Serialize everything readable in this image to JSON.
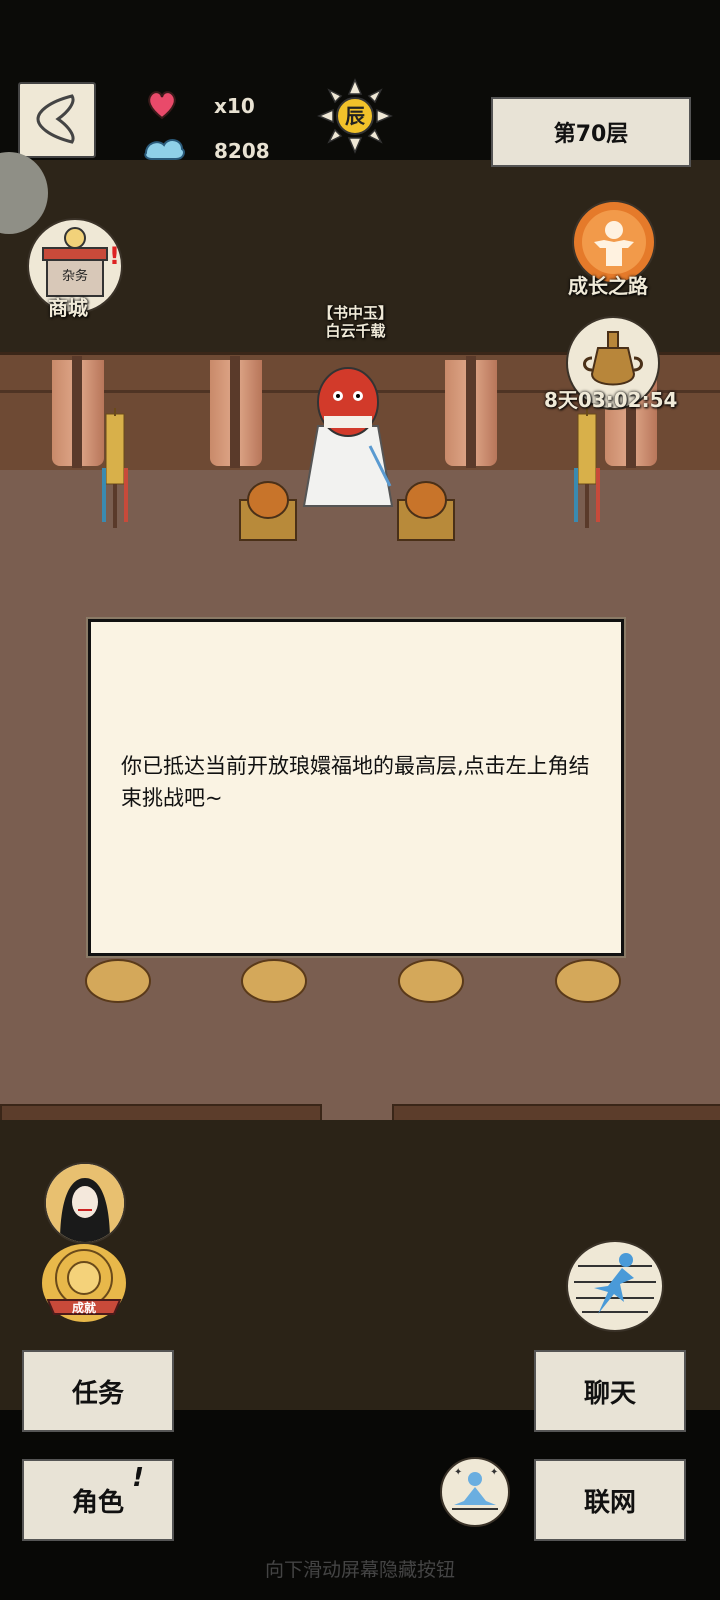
{
  "header": {
    "lives": "x10",
    "currency": "8208",
    "time_badge": "辰",
    "floor": "第70层"
  },
  "left_menu": {
    "shop_label": "商城",
    "shop_sign": "杂务"
  },
  "right_menu": {
    "growth_label": "成长之路",
    "event_timer": "8天03:02:54"
  },
  "npc": {
    "title_line1": "【书中玉】",
    "title_line2": "白云千载"
  },
  "dialog": {
    "message": "你已抵达当前开放琅嬛福地的最高层,点击左上角结束挑战吧~"
  },
  "achievement": {
    "ribbon": "成就"
  },
  "buttons": {
    "task": "任务",
    "role": "角色",
    "role_badge": "!",
    "chat": "聊天",
    "network": "联网"
  },
  "hint": "向下滑动屏幕隐藏按钮",
  "colors": {
    "panel": "#e8e3d6",
    "dialog_bg": "#faf3e3",
    "floor": "#7a5e50",
    "wall": "#6e4a34"
  }
}
